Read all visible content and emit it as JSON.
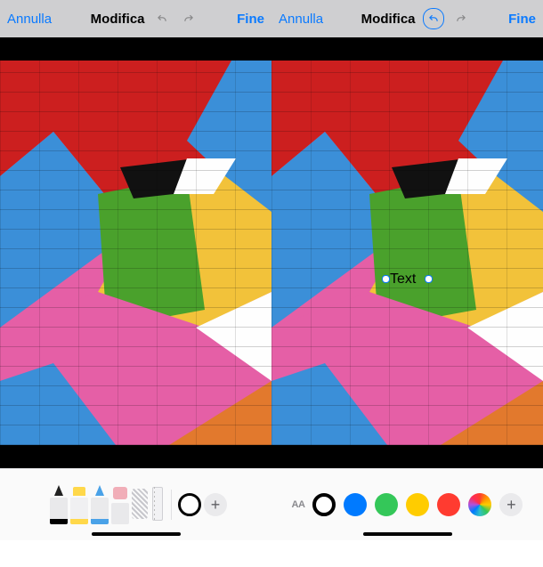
{
  "left": {
    "topbar": {
      "cancel": "Annulla",
      "title": "Modifica",
      "done": "Fine"
    },
    "tools": {
      "colorwell_hex": "#000000"
    }
  },
  "right": {
    "topbar": {
      "cancel": "Annulla",
      "title": "Modifica",
      "done": "Fine"
    },
    "annotation_text": "Text",
    "text_toolbar": {
      "selected_color": "#000000",
      "font_size_label": "AA",
      "colors": [
        "#007aff",
        "#34c759",
        "#ffcc00",
        "#ff3b30"
      ]
    }
  },
  "icons": {
    "plus": "+"
  }
}
